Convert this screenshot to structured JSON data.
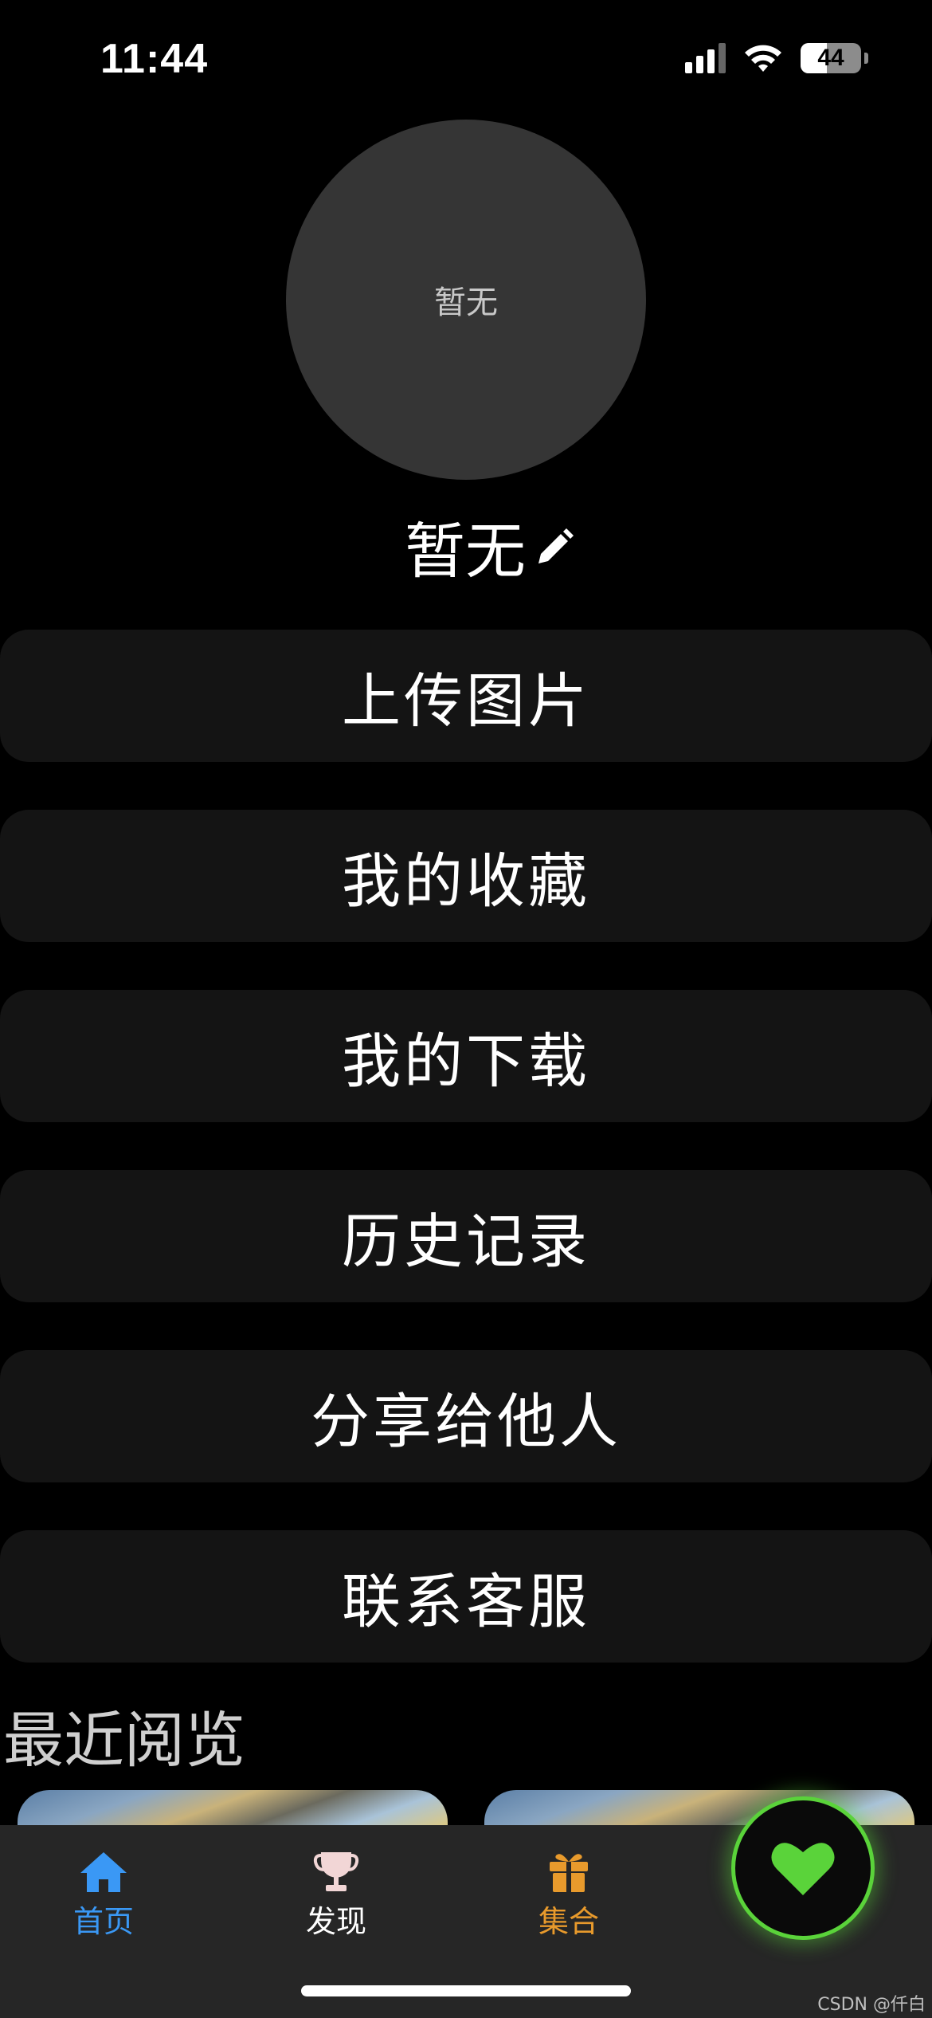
{
  "status_bar": {
    "time": "11:44",
    "battery_level": "44",
    "battery_fraction": 0.44,
    "icons": [
      "cellular-signal-icon",
      "wifi-icon",
      "battery-icon"
    ]
  },
  "profile": {
    "avatar_placeholder": "暂无",
    "username": "暂无",
    "edit_icon": "pencil-icon"
  },
  "menu": {
    "items": [
      {
        "label": "上传图片"
      },
      {
        "label": "我的收藏"
      },
      {
        "label": "我的下载"
      },
      {
        "label": "历史记录"
      },
      {
        "label": "分享给他人"
      },
      {
        "label": "联系客服"
      }
    ]
  },
  "recent": {
    "title": "最近阅览"
  },
  "tab_bar": {
    "tabs": [
      {
        "label": "首页",
        "icon": "house-icon",
        "color": "#3a98f5"
      },
      {
        "label": "发现",
        "icon": "trophy-icon",
        "color": "#ffffff"
      },
      {
        "label": "集合",
        "icon": "gift-icon",
        "color": "#e89a2c"
      }
    ],
    "fab_icon": "heart-icon",
    "fab_color": "#5ad33a"
  },
  "watermark": "CSDN @仟白"
}
